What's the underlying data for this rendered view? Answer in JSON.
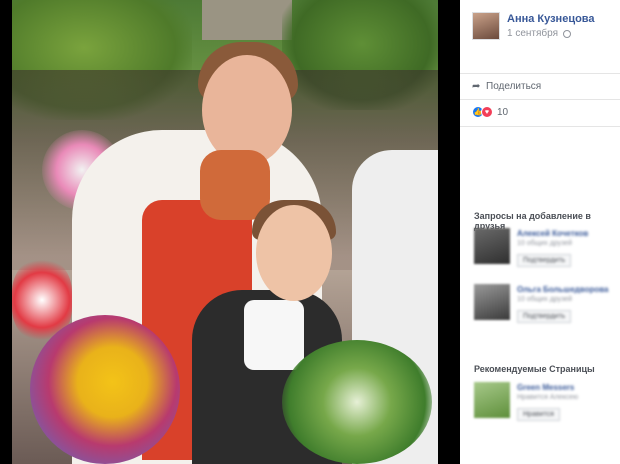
{
  "post": {
    "author": "Анна Кузнецова",
    "date": "1 сентября",
    "share_label": "Поделиться",
    "reactions_count": "10"
  },
  "sidebar": {
    "friend_requests_title": "Запросы на добавление в друзья",
    "friend_requests": [
      {
        "name": "Алексей Кочетков",
        "mutual": "10 общих друзей",
        "button": "Подтвердить"
      },
      {
        "name": "Ольга Большедворова",
        "mutual": "10 общих друзей",
        "button": "Подтвердить"
      }
    ],
    "recommended_title": "Рекомендуемые Страницы",
    "recommended_pages": [
      {
        "name": "Green Messers",
        "sub": "Нравится Алексею",
        "button": "Нравится"
      }
    ]
  },
  "colors": {
    "link": "#385898",
    "like": "#1877f2",
    "love": "#f33e58"
  }
}
